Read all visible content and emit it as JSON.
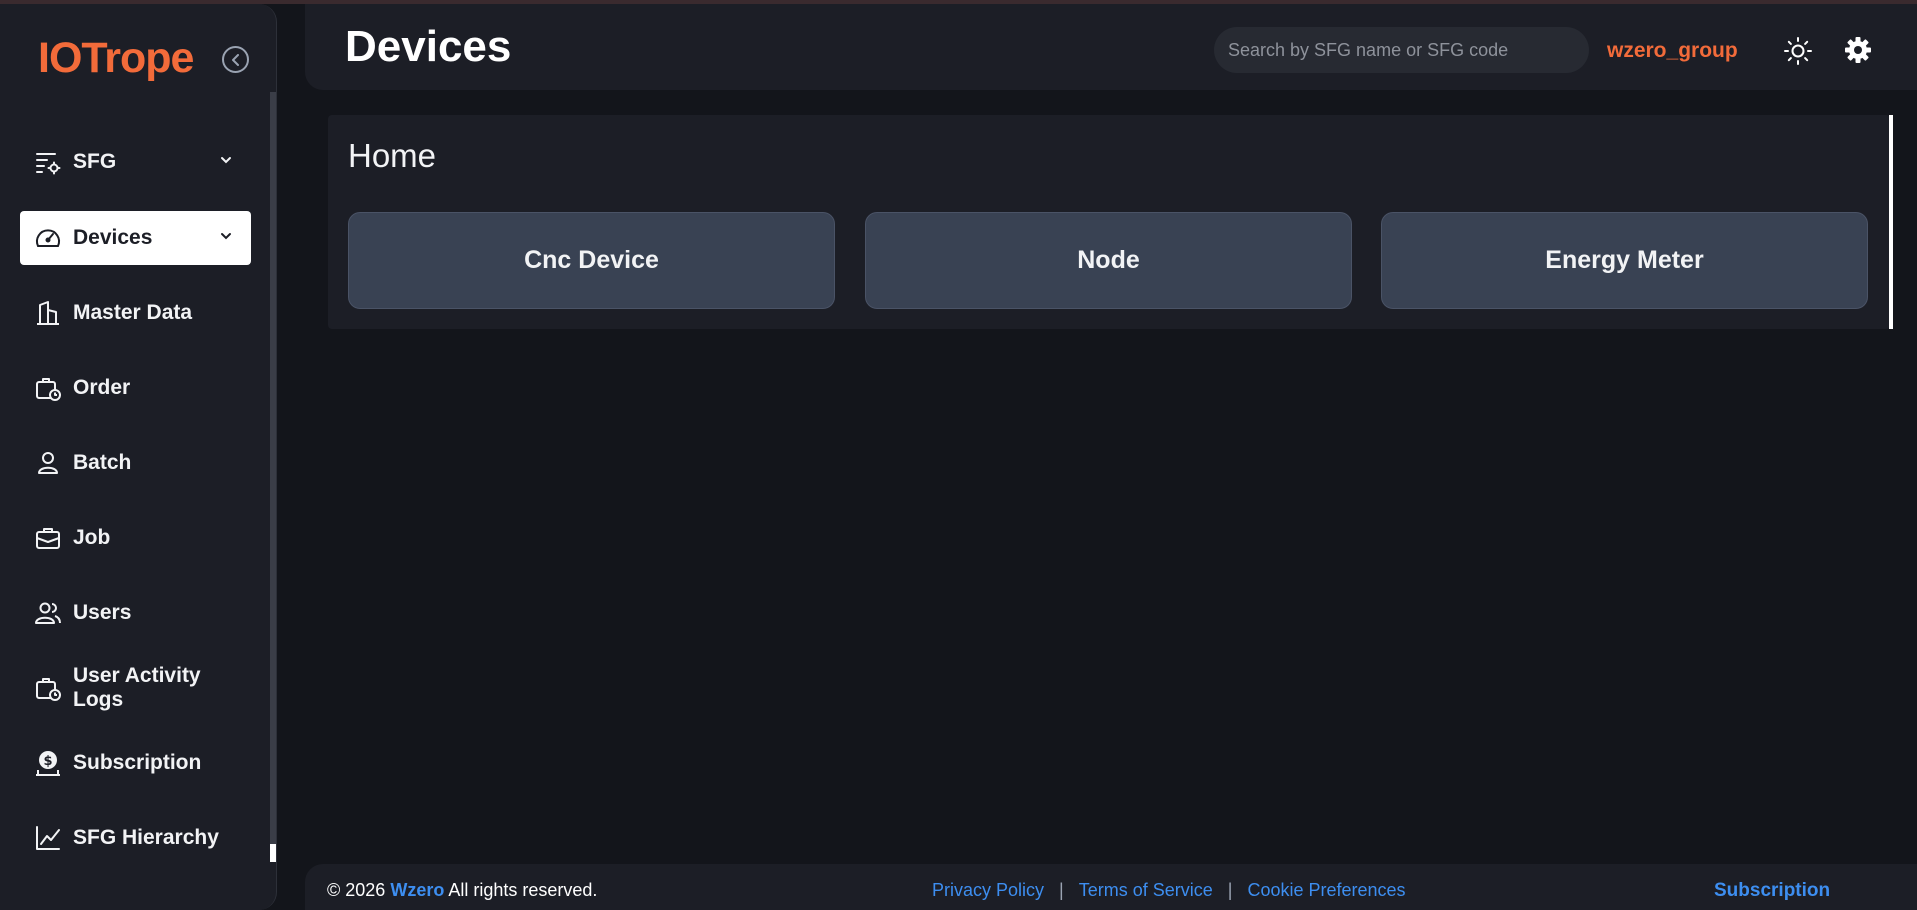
{
  "app": {
    "logo_text": "IOTrope"
  },
  "header": {
    "title": "Devices",
    "search_placeholder": "Search by SFG name or SFG code",
    "search_value": "",
    "group_name": "wzero_group",
    "icons": {
      "theme": "sun-icon",
      "settings": "gear-icon"
    }
  },
  "sidebar": {
    "collapse_icon": "chevron-left-circle-icon",
    "items": [
      {
        "label": "SFG",
        "icon": "list-settings-icon",
        "has_chevron": true,
        "active": false
      },
      {
        "label": "Devices",
        "icon": "speedometer-icon",
        "has_chevron": true,
        "active": true
      },
      {
        "label": "Master Data",
        "icon": "building-icon",
        "has_chevron": false,
        "active": false
      },
      {
        "label": "Order",
        "icon": "briefcase-clock-icon",
        "has_chevron": false,
        "active": false
      },
      {
        "label": "Batch",
        "icon": "person-icon",
        "has_chevron": false,
        "active": false
      },
      {
        "label": "Job",
        "icon": "briefcase-icon",
        "has_chevron": false,
        "active": false
      },
      {
        "label": "Users",
        "icon": "users-icon",
        "has_chevron": false,
        "active": false
      },
      {
        "label": "User Activity Logs",
        "icon": "briefcase-clock-icon",
        "has_chevron": false,
        "active": false
      },
      {
        "label": "Subscription",
        "icon": "dollar-coin-icon",
        "has_chevron": false,
        "active": false
      },
      {
        "label": "SFG Hierarchy",
        "icon": "line-chart-icon",
        "has_chevron": false,
        "active": false
      }
    ]
  },
  "main": {
    "section_title": "Home",
    "device_buttons": [
      "Cnc Device",
      "Node",
      "Energy Meter"
    ]
  },
  "footer": {
    "copyright_prefix": "© 2026",
    "brand": "Wzero",
    "copyright_suffix": "All rights reserved.",
    "links": [
      "Privacy Policy",
      "Terms of Service",
      "Cookie Preferences"
    ],
    "separator": "|",
    "subscription": "Subscription"
  },
  "colors": {
    "accent": "#f26b3a",
    "link": "#3d8ef0",
    "background": "#13151b",
    "panel": "#1c1e26",
    "device_button": "#394253"
  }
}
